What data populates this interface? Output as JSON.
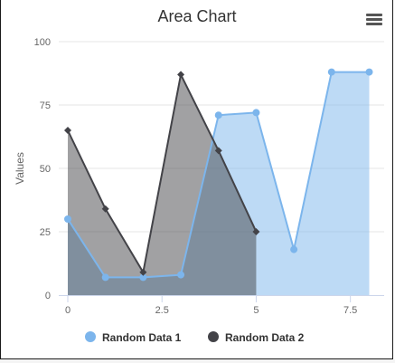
{
  "chart_data": {
    "type": "area",
    "title": "Area Chart",
    "ylabel": "Values",
    "xlabel": "",
    "xlim": [
      0,
      8.3
    ],
    "ylim": [
      0,
      100
    ],
    "x_ticks": [
      0,
      2.5,
      5,
      7.5
    ],
    "x_tick_labels": [
      "0",
      "2.5",
      "5",
      "7.5"
    ],
    "y_ticks": [
      0,
      25,
      50,
      75,
      100
    ],
    "y_tick_labels": [
      "0",
      "25",
      "50",
      "75",
      "100"
    ],
    "grid": "horizontal",
    "legend_position": "bottom-center",
    "series": [
      {
        "name": "Random Data 1",
        "color": "#7cb5ec",
        "marker": "circle",
        "x": [
          0,
          1,
          2,
          3,
          4,
          5,
          6,
          7,
          8
        ],
        "values": [
          30,
          7,
          7,
          8,
          71,
          72,
          18,
          88,
          88
        ]
      },
      {
        "name": "Random Data 2",
        "color": "#434348",
        "marker": "diamond",
        "x": [
          0,
          1,
          2,
          3,
          4,
          5
        ],
        "values": [
          65,
          34,
          9,
          87,
          57,
          25
        ]
      }
    ]
  },
  "menu_icon": "hamburger-menu-icon"
}
